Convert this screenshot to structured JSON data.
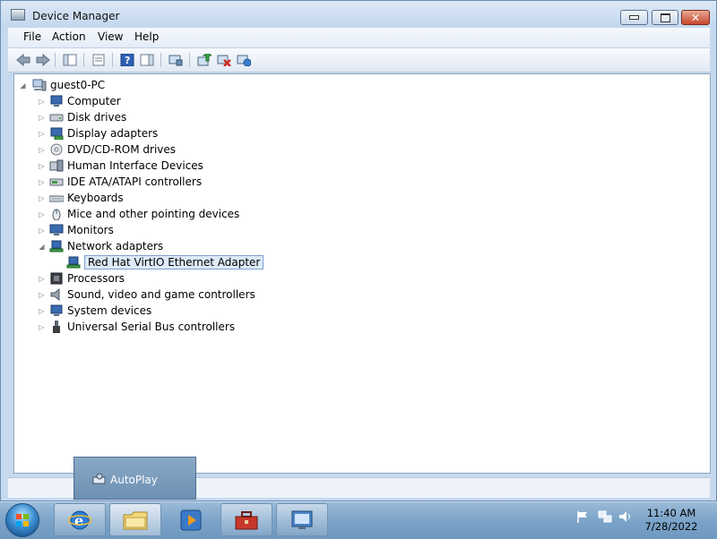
{
  "window": {
    "title": "Device Manager",
    "icon": "device-manager-icon"
  },
  "caption_buttons": {
    "minimize": "minimize",
    "maximize": "maximize",
    "close": "close"
  },
  "menu": [
    "File",
    "Action",
    "View",
    "Help"
  ],
  "toolbar": [
    "back-icon",
    "forward-icon",
    "show-hide-console-tree-icon",
    "properties-icon",
    "help-icon",
    "action-pane-icon",
    "scan-hardware-changes-icon",
    "update-driver-icon",
    "uninstall-icon",
    "enable-device-icon"
  ],
  "tree": {
    "root": "guest0-PC",
    "categories": [
      {
        "label": "Computer",
        "expanded": false
      },
      {
        "label": "Disk drives",
        "expanded": false
      },
      {
        "label": "Display adapters",
        "expanded": false
      },
      {
        "label": "DVD/CD-ROM drives",
        "expanded": false
      },
      {
        "label": "Human Interface Devices",
        "expanded": false
      },
      {
        "label": "IDE ATA/ATAPI controllers",
        "expanded": false
      },
      {
        "label": "Keyboards",
        "expanded": false
      },
      {
        "label": "Mice and other pointing devices",
        "expanded": false
      },
      {
        "label": "Monitors",
        "expanded": false
      },
      {
        "label": "Network adapters",
        "expanded": true
      },
      {
        "label": "Processors",
        "expanded": false
      },
      {
        "label": "Sound, video and game controllers",
        "expanded": false
      },
      {
        "label": "System devices",
        "expanded": false
      },
      {
        "label": "Universal Serial Bus controllers",
        "expanded": false
      }
    ],
    "network_child": "Red Hat VirtIO Ethernet Adapter"
  },
  "autoplay": {
    "label": "AutoPlay"
  },
  "taskbar": {
    "buttons": [
      "internet-explorer-icon",
      "windows-explorer-icon",
      "media-player-icon",
      "toolbox-icon",
      "device-manager-icon"
    ],
    "clock": {
      "time": "11:40 AM",
      "date": "7/28/2022"
    }
  }
}
